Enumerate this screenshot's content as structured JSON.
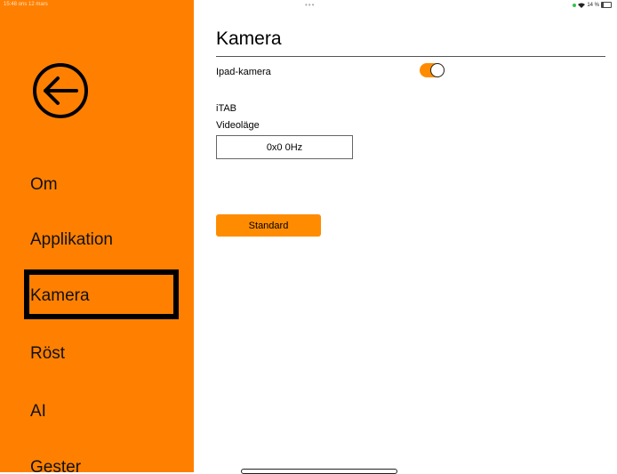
{
  "status_bar": {
    "time": "15:48  ons 12 mars",
    "dots": "•••",
    "battery_text": "14 %"
  },
  "sidebar": {
    "items": [
      {
        "label": "Om"
      },
      {
        "label": "Applikation"
      },
      {
        "label": "Kamera",
        "selected": true
      },
      {
        "label": "Röst"
      },
      {
        "label": "AI"
      },
      {
        "label": "Gester"
      }
    ]
  },
  "main": {
    "title": "Kamera",
    "ipad_camera_label": "Ipad-kamera",
    "ipad_camera_on": true,
    "device_name": "iTAB",
    "video_mode_label": "Videoläge",
    "video_mode_value": "0x0 0Hz",
    "standard_button": "Standard"
  },
  "colors": {
    "sidebar": "#ff8000",
    "accent": "#ff8c00"
  }
}
